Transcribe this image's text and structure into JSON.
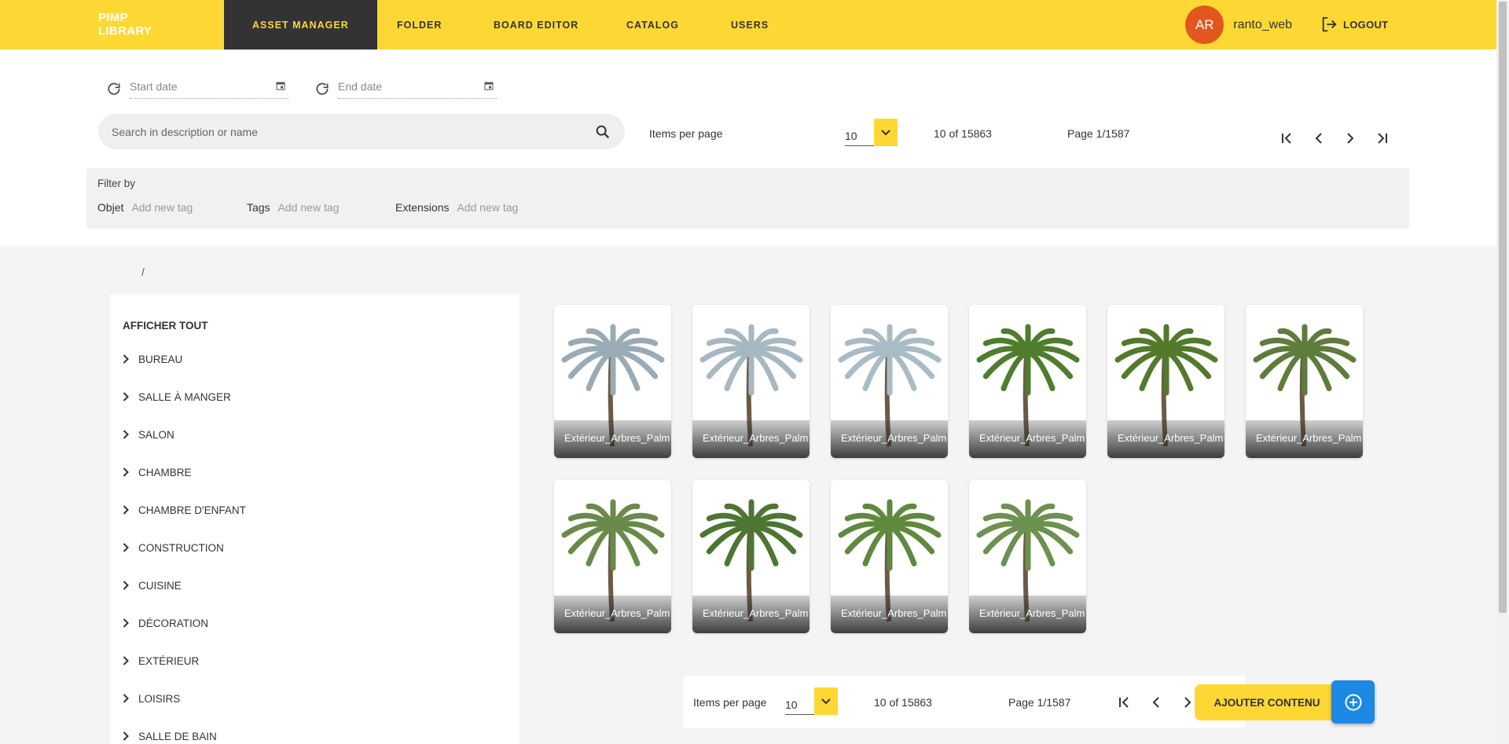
{
  "brand": {
    "line1": "PIMP",
    "line2": "LIBRARY"
  },
  "nav": {
    "asset_manager": "ASSET MANAGER",
    "folder": "FOLDER",
    "board_editor": "BOARD EDITOR",
    "catalog": "CATALOG",
    "users": "USERS"
  },
  "user": {
    "initials": "AR",
    "name": "ranto_web",
    "logout": "LOGOUT"
  },
  "filters": {
    "start_date_placeholder": "Start date",
    "end_date_placeholder": "End date",
    "search_placeholder": "Search in description or name",
    "filter_by": "Filter by",
    "objet_label": "Objet",
    "tags_label": "Tags",
    "extensions_label": "Extensions",
    "add_tag": "Add new tag"
  },
  "pager": {
    "items_per_page_label": "Items per page",
    "items_per_page": "10",
    "count": "10 of 15863",
    "page": "Page 1/1587"
  },
  "breadcrumb": "/",
  "sidebar": {
    "show_all": "AFFICHER TOUT",
    "categories": [
      "BUREAU",
      "SALLE À MANGER",
      "SALON",
      "CHAMBRE",
      "CHAMBRE D'ENFANT",
      "CONSTRUCTION",
      "CUISINE",
      "DÉCORATION",
      "EXTÉRIEUR",
      "LOISIRS",
      "SALLE DE BAIN"
    ]
  },
  "assets": [
    {
      "caption": "Extérieur_Arbres_Palm",
      "color": "#9aabb5"
    },
    {
      "caption": "Extérieur_Arbres_Palm",
      "color": "#a7b8c2"
    },
    {
      "caption": "Extérieur_Arbres_Palm",
      "color": "#a9bcc6"
    },
    {
      "caption": "Extérieur_Arbres_Palm",
      "color": "#4f7d2e"
    },
    {
      "caption": "Extérieur_Arbres_Palm",
      "color": "#527a2a"
    },
    {
      "caption": "Extérieur_Arbres_Palm",
      "color": "#5e7c3c"
    },
    {
      "caption": "Extérieur_Arbres_Palm",
      "color": "#6a8a4a"
    },
    {
      "caption": "Extérieur_Arbres_Palm",
      "color": "#4d7632"
    },
    {
      "caption": "Extérieur_Arbres_Palm",
      "color": "#5f8a3e"
    },
    {
      "caption": "Extérieur_Arbres_Palm",
      "color": "#6d9150"
    }
  ],
  "actions": {
    "add_content": "AJOUTER CONTENU"
  },
  "colors": {
    "accent": "#fdd835",
    "dark": "#333333",
    "avatar": "#e2571e",
    "fab": "#1e88e5"
  }
}
